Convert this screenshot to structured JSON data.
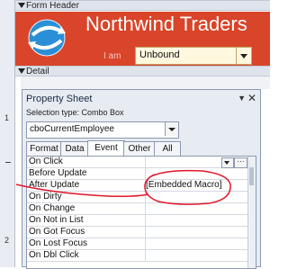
{
  "sections": {
    "form_header": "Form Header",
    "detail": "Detail"
  },
  "header": {
    "title": "Northwind Traders",
    "i_am_label": "I am",
    "combo_value": "Unbound"
  },
  "ruler": [
    "1",
    "2"
  ],
  "property_sheet": {
    "title": "Property Sheet",
    "selection_type": "Selection type:  Combo Box",
    "selected_object": "cboCurrentEmployee",
    "tabs": [
      "Format",
      "Data",
      "Event",
      "Other",
      "All"
    ],
    "active_tab": "Event",
    "rows": [
      {
        "label": "On Click",
        "value": ""
      },
      {
        "label": "Before Update",
        "value": ""
      },
      {
        "label": "After Update",
        "value": "[Embedded Macro]"
      },
      {
        "label": "On Dirty",
        "value": ""
      },
      {
        "label": "On Change",
        "value": ""
      },
      {
        "label": "On Not in List",
        "value": ""
      },
      {
        "label": "On Got Focus",
        "value": ""
      },
      {
        "label": "On Lost Focus",
        "value": ""
      },
      {
        "label": "On Dbl Click",
        "value": ""
      }
    ]
  },
  "colors": {
    "header_red": "#d8452a",
    "ink_red": "#e0182b",
    "combo_bg": "#fff8df"
  }
}
